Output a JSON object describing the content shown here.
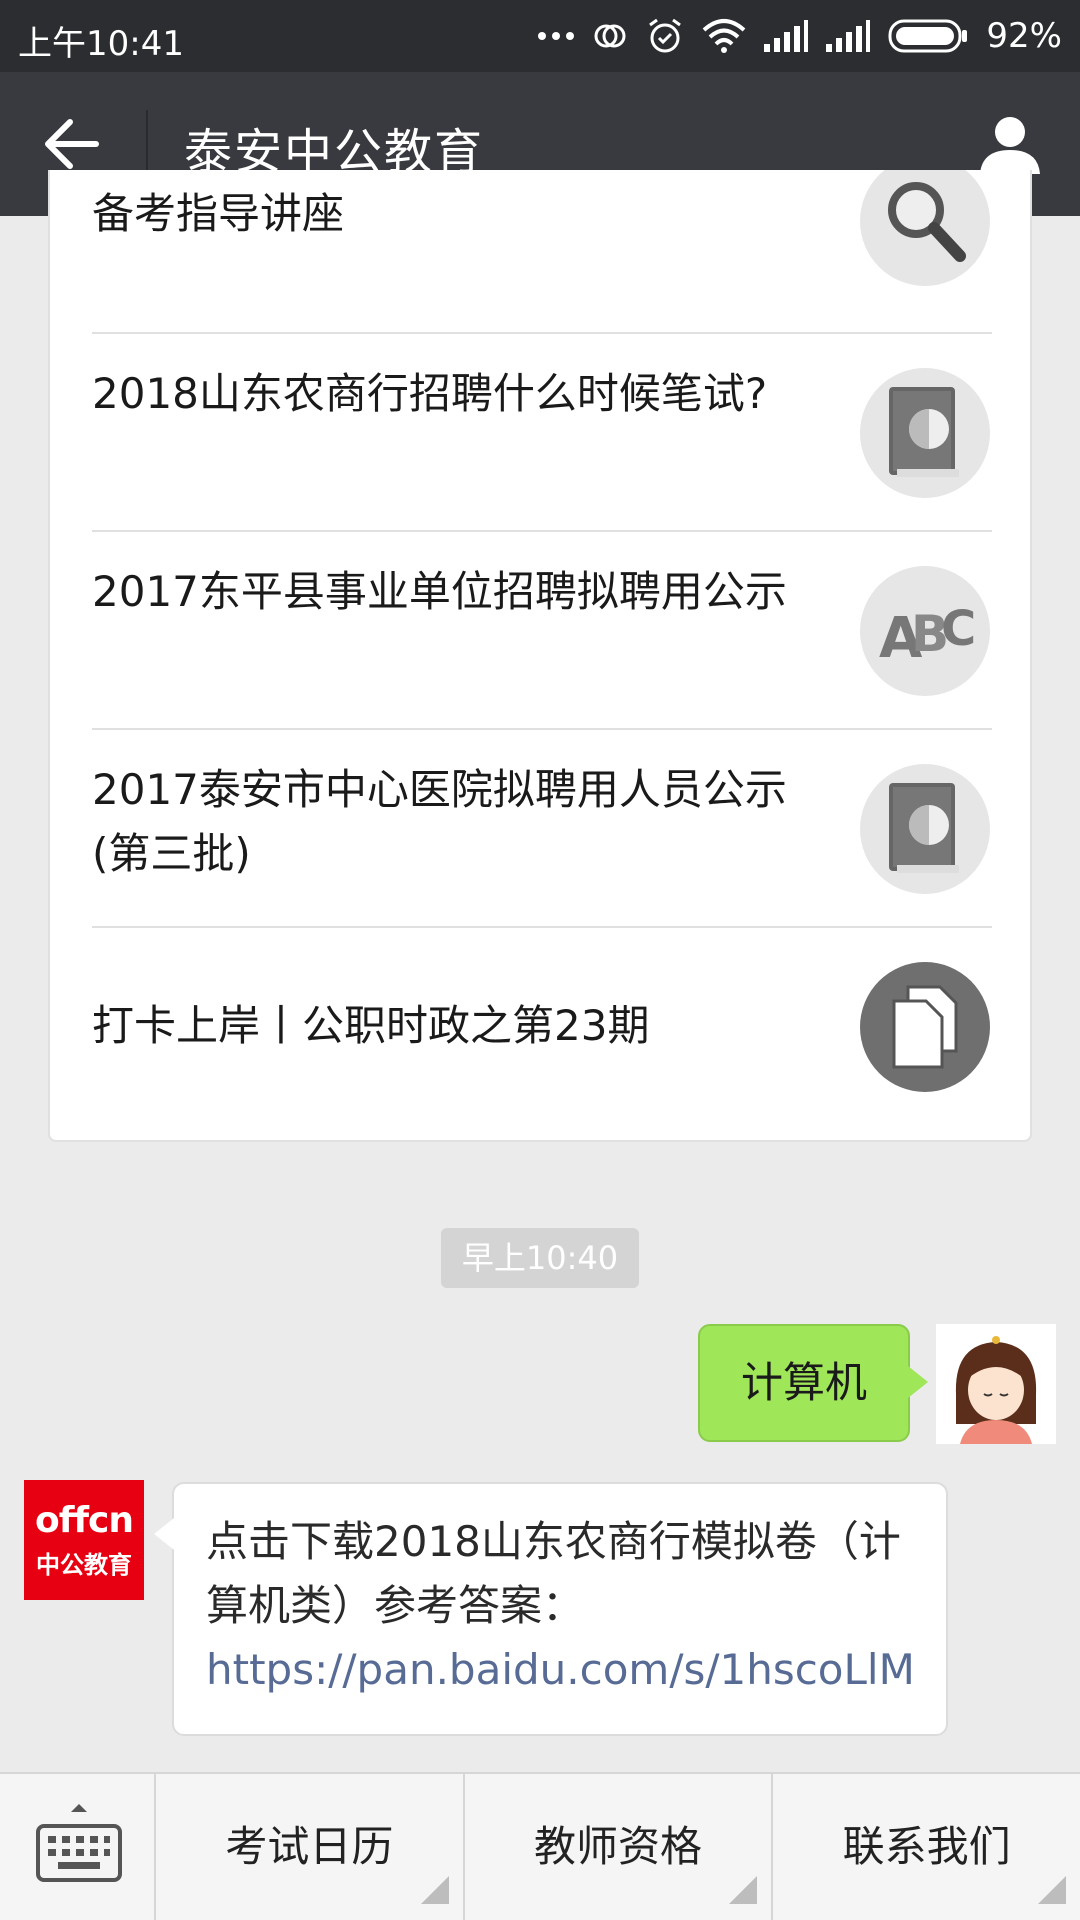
{
  "status_bar": {
    "time": "上午10:41",
    "battery_pct": "92%",
    "icons": [
      "more-dots-icon",
      "sync-icon",
      "alarm-icon",
      "wifi-icon",
      "signal-icon",
      "signal-icon",
      "battery-icon"
    ]
  },
  "nav": {
    "title": "泰安中公教育"
  },
  "articles": [
    {
      "title": "备考指导讲座",
      "thumb": "magnifier-icon"
    },
    {
      "title": "2018山东农商行招聘什么时候笔试?",
      "thumb": "book-icon"
    },
    {
      "title": "2017东平县事业单位招聘拟聘用公示",
      "thumb": "abc-icon"
    },
    {
      "title": "2017泰安市中心医院拟聘用人员公示(第三批)",
      "thumb": "book-icon"
    },
    {
      "title": "打卡上岸丨公职时政之第23期",
      "thumb": "document-icon"
    }
  ],
  "chat": {
    "timestamp": "早上10:40",
    "sent": {
      "text": "计算机"
    },
    "received": {
      "logo_text_1": "offcn",
      "logo_text_2": "中公教育",
      "text": "点击下载2018山东农商行模拟卷（计算机类）参考答案：",
      "link": "https://pan.baidu.com/s/1hscoLlM"
    }
  },
  "bottom_menu": {
    "items": [
      "考试日历",
      "教师资格",
      "联系我们"
    ]
  },
  "colors": {
    "nav_bg": "#393a3f",
    "sent_bubble": "#9fe659",
    "link": "#576b95",
    "brand_red": "#e60012"
  }
}
